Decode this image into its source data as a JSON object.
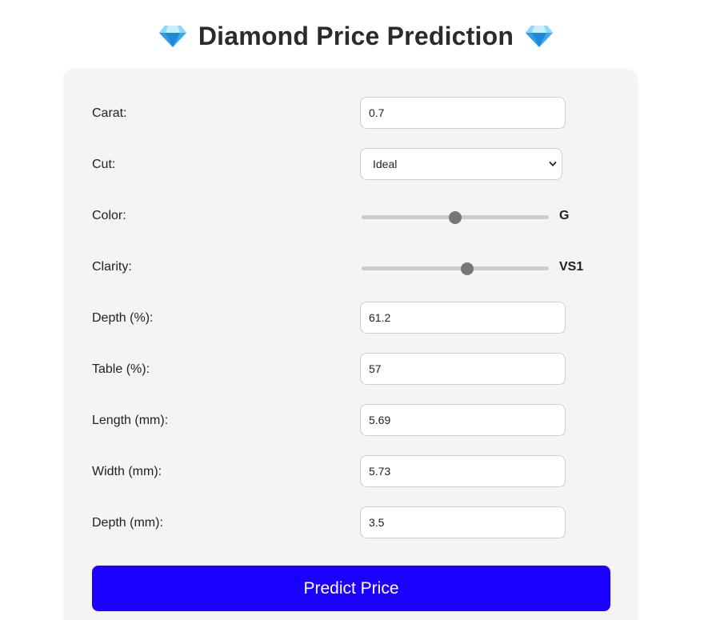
{
  "header": {
    "title": "Diamond Price Prediction",
    "icon_left": "diamond-icon",
    "icon_right": "diamond-icon"
  },
  "form": {
    "carat": {
      "label": "Carat:",
      "value": "0.7"
    },
    "cut": {
      "label": "Cut:",
      "value": "Ideal"
    },
    "color": {
      "label": "Color:",
      "value": "G",
      "slider_fraction": 0.5
    },
    "clarity": {
      "label": "Clarity:",
      "value": "VS1",
      "slider_fraction": 0.57
    },
    "depth_pct": {
      "label": "Depth (%):",
      "value": "61.2"
    },
    "table_pct": {
      "label": "Table (%):",
      "value": "57"
    },
    "length_mm": {
      "label": "Length (mm):",
      "value": "5.69"
    },
    "width_mm": {
      "label": "Width (mm):",
      "value": "5.73"
    },
    "depth_mm": {
      "label": "Depth (mm):",
      "value": "3.5"
    },
    "submit_label": "Predict Price"
  },
  "colors": {
    "accent": "#1a00ff",
    "card_background": "#f4f4f4",
    "slider_track": "#cccccc",
    "slider_thumb": "#777777"
  }
}
